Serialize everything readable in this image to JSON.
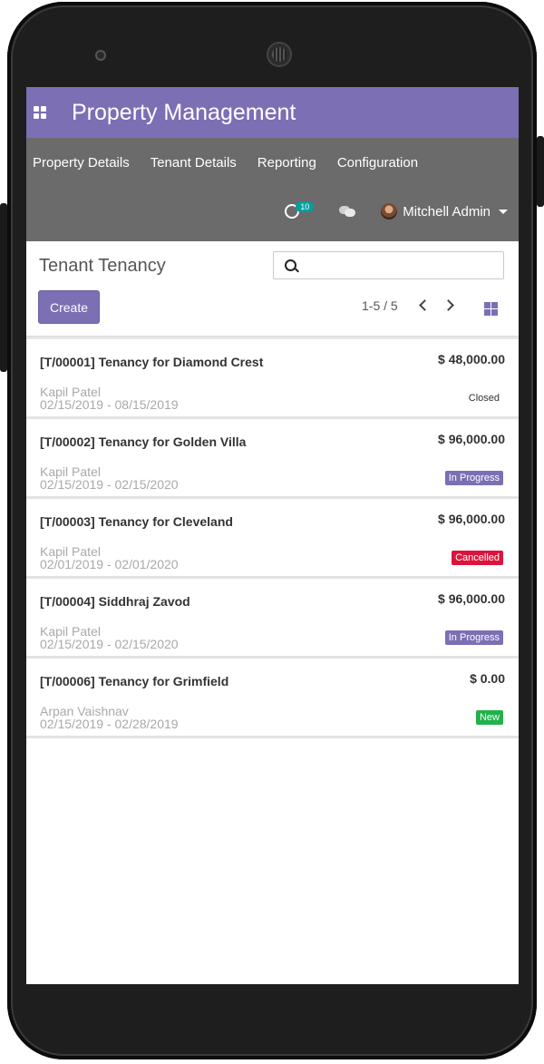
{
  "app": {
    "title": "Property Management"
  },
  "menu": {
    "items": [
      {
        "label": "Property Details"
      },
      {
        "label": "Tenant Details"
      },
      {
        "label": "Reporting"
      },
      {
        "label": "Configuration"
      }
    ]
  },
  "systray": {
    "activity_count": "10",
    "user_name": "Mitchell Admin"
  },
  "control": {
    "breadcrumb": "Tenant Tenancy",
    "search_placeholder": "",
    "create_label": "Create",
    "pager": "1-5 / 5"
  },
  "colors": {
    "brand": "#7c6fb4",
    "menubar": "#6b6b6b",
    "cancelled": "#dc143c",
    "new": "#21b14a"
  },
  "records": [
    {
      "title": "[T/00001] Tenancy for Diamond Crest",
      "amount": "$ 48,000.00",
      "tenant": "Kapil Patel",
      "dates": "02/15/2019 - 08/15/2019",
      "status": "Closed"
    },
    {
      "title": "[T/00002] Tenancy for Golden Villa",
      "amount": "$ 96,000.00",
      "tenant": "Kapil Patel",
      "dates": "02/15/2019 - 02/15/2020",
      "status": "In Progress"
    },
    {
      "title": "[T/00003] Tenancy for Cleveland",
      "amount": "$ 96,000.00",
      "tenant": "Kapil Patel",
      "dates": "02/01/2019 - 02/01/2020",
      "status": "Cancelled"
    },
    {
      "title": "[T/00004] Siddhraj Zavod",
      "amount": "$ 96,000.00",
      "tenant": "Kapil Patel",
      "dates": "02/15/2019 - 02/15/2020",
      "status": "In Progress"
    },
    {
      "title": "[T/00006] Tenancy for Grimfield",
      "amount": "$ 0.00",
      "tenant": "Arpan Vaishnav",
      "dates": "02/15/2019 - 02/28/2019",
      "status": "New"
    }
  ]
}
